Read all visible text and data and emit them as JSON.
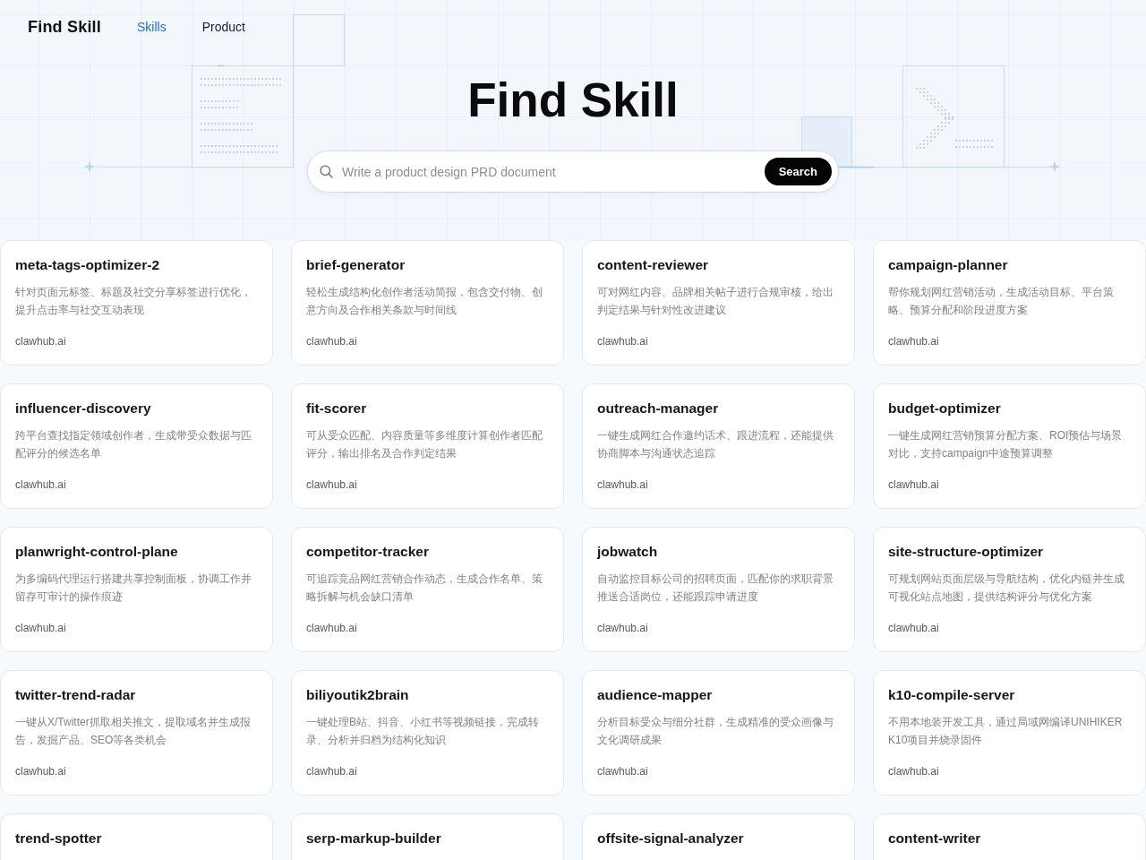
{
  "header": {
    "logo": "Find Skill",
    "nav": [
      {
        "label": "Skills",
        "selected": true
      },
      {
        "label": "Product",
        "selected": false
      }
    ]
  },
  "hero": {
    "title": "Find Skill",
    "search": {
      "placeholder": "Write a product design PRD document",
      "button": "Search"
    }
  },
  "skills": [
    {
      "name": "meta-tags-optimizer-2",
      "description": "针对页面元标签、标题及社交分享标签进行优化，提升点击率与社交互动表现",
      "source": "clawhub.ai"
    },
    {
      "name": "brief-generator",
      "description": "轻松生成结构化创作者活动简报，包含交付物、创意方向及合作相关条款与时间线",
      "source": "clawhub.ai"
    },
    {
      "name": "content-reviewer",
      "description": "可对网红内容、品牌相关帖子进行合规审核，给出判定结果与针对性改进建议",
      "source": "clawhub.ai"
    },
    {
      "name": "campaign-planner",
      "description": "帮你规划网红营销活动，生成活动目标、平台策略、预算分配和阶段进度方案",
      "source": "clawhub.ai"
    },
    {
      "name": "influencer-discovery",
      "description": "跨平台查找指定领域创作者，生成带受众数据与匹配评分的候选名单",
      "source": "clawhub.ai"
    },
    {
      "name": "fit-scorer",
      "description": "可从受众匹配、内容质量等多维度计算创作者匹配评分，输出排名及合作判定结果",
      "source": "clawhub.ai"
    },
    {
      "name": "outreach-manager",
      "description": "一键生成网红合作邀约话术、跟进流程，还能提供协商脚本与沟通状态追踪",
      "source": "clawhub.ai"
    },
    {
      "name": "budget-optimizer",
      "description": "一键生成网红营销预算分配方案、ROI预估与场景对比，支持campaign中途预算调整",
      "source": "clawhub.ai"
    },
    {
      "name": "planwright-control-plane",
      "description": "为多编码代理运行搭建共享控制面板，协调工作并留存可审计的操作痕迹",
      "source": "clawhub.ai"
    },
    {
      "name": "competitor-tracker",
      "description": "可追踪竞品网红营销合作动态，生成合作名单、策略拆解与机会缺口清单",
      "source": "clawhub.ai"
    },
    {
      "name": "jobwatch",
      "description": "自动监控目标公司的招聘页面，匹配你的求职背景推送合适岗位，还能跟踪申请进度",
      "source": "clawhub.ai"
    },
    {
      "name": "site-structure-optimizer",
      "description": "可规划网站页面层级与导航结构，优化内链并生成可视化站点地图，提供结构评分与优化方案",
      "source": "clawhub.ai"
    },
    {
      "name": "twitter-trend-radar",
      "description": "一键从X/Twitter抓取相关推文，提取域名并生成报告，发掘产品、SEO等各类机会",
      "source": "clawhub.ai"
    },
    {
      "name": "biliyoutik2brain",
      "description": "一键处理B站、抖音、小红书等视频链接，完成转录、分析并归档为结构化知识",
      "source": "clawhub.ai"
    },
    {
      "name": "audience-mapper",
      "description": "分析目标受众与细分社群，生成精准的受众画像与文化调研成果",
      "source": "clawhub.ai"
    },
    {
      "name": "k10-compile-server",
      "description": "不用本地装开发工具，通过局域网编译UNIHIKER K10项目并烧录固件",
      "source": "clawhub.ai"
    },
    {
      "name": "trend-spotter"
    },
    {
      "name": "serp-markup-builder"
    },
    {
      "name": "offsite-signal-analyzer"
    },
    {
      "name": "content-writer"
    }
  ]
}
